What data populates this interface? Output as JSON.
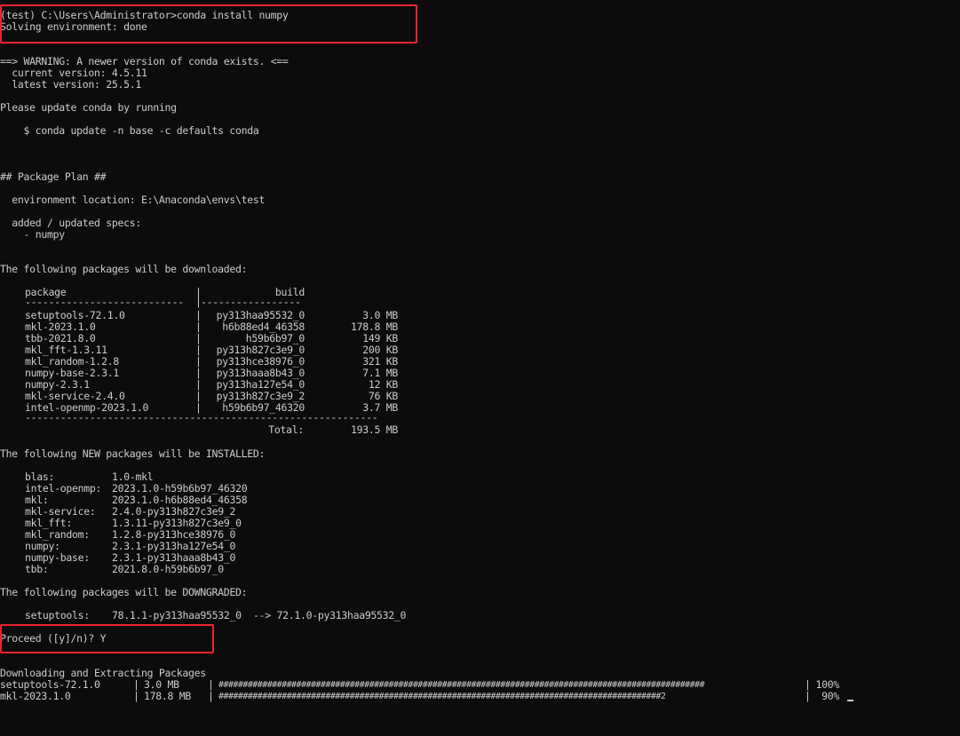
{
  "header": {
    "prompt": "(test) C:\\Users\\Administrator>conda install numpy",
    "solving": "Solving environment: done"
  },
  "warning": {
    "line1": "==> WARNING: A newer version of conda exists. <==",
    "current": "  current version: 4.5.11",
    "latest": "  latest version: 25.5.1",
    "update_msg": "Please update conda by running",
    "update_cmd": "    $ conda update -n base -c defaults conda"
  },
  "plan": {
    "title": "## Package Plan ##",
    "env_location": "  environment location: E:\\Anaconda\\envs\\test",
    "specs_label": "  added / updated specs:",
    "spec_item": "    - numpy"
  },
  "download": {
    "heading": "The following packages will be downloaded:",
    "col_package": "package",
    "col_build": "build",
    "dash_left": "---------------------------",
    "dash_right": "-----------------",
    "sep": "|",
    "rows": [
      {
        "package": "setuptools-72.1.0",
        "build": "py313haa95532_0",
        "size": "3.0 MB"
      },
      {
        "package": "mkl-2023.1.0",
        "build": "h6b88ed4_46358",
        "size": "178.8 MB"
      },
      {
        "package": "tbb-2021.8.0",
        "build": "h59b6b97_0",
        "size": "149 KB"
      },
      {
        "package": "mkl_fft-1.3.11",
        "build": "py313h827c3e9_0",
        "size": "200 KB"
      },
      {
        "package": "mkl_random-1.2.8",
        "build": "py313hce38976_0",
        "size": "321 KB"
      },
      {
        "package": "numpy-base-2.3.1",
        "build": "py313haaa8b43_0",
        "size": "7.1 MB"
      },
      {
        "package": "numpy-2.3.1",
        "build": "py313ha127e54_0",
        "size": "12 KB"
      },
      {
        "package": "mkl-service-2.4.0",
        "build": "py313h827c3e9_2",
        "size": "76 KB"
      },
      {
        "package": "intel-openmp-2023.1.0",
        "build": "h59b6b97_46320",
        "size": "3.7 MB"
      }
    ],
    "footer_dash": "------------------------------------------------------------",
    "total_label": "Total:",
    "total_value": "193.5 MB"
  },
  "new_pkgs": {
    "heading": "The following NEW packages will be INSTALLED:",
    "rows": [
      {
        "name": "blas:",
        "spec": "1.0-mkl"
      },
      {
        "name": "intel-openmp:",
        "spec": "2023.1.0-h59b6b97_46320"
      },
      {
        "name": "mkl:",
        "spec": "2023.1.0-h6b88ed4_46358"
      },
      {
        "name": "mkl-service:",
        "spec": "2.4.0-py313h827c3e9_2"
      },
      {
        "name": "mkl_fft:",
        "spec": "1.3.11-py313h827c3e9_0"
      },
      {
        "name": "mkl_random:",
        "spec": "1.2.8-py313hce38976_0"
      },
      {
        "name": "numpy:",
        "spec": "2.3.1-py313ha127e54_0"
      },
      {
        "name": "numpy-base:",
        "spec": "2.3.1-py313haaa8b43_0"
      },
      {
        "name": "tbb:",
        "spec": "2021.8.0-h59b6b97_0"
      }
    ]
  },
  "downgraded": {
    "heading": "The following packages will be DOWNGRADED:",
    "name": "setuptools:",
    "spec": "78.1.1-py313haa95532_0  --> 72.1.0-py313haa95532_0"
  },
  "proceed": "Proceed ([y]/n)? Y",
  "progress": {
    "heading": "Downloading and Extracting Packages",
    "rows": [
      {
        "name": "setuptools-72.1.0",
        "size": "3.0 MB",
        "bar": "####################################################################################################",
        "pct": "100%",
        "fraction": 1.0
      },
      {
        "name": "mkl-2023.1.0",
        "size": "178.8 MB",
        "bar": "###########################################################################################2",
        "pct": "90%",
        "fraction": 0.9
      }
    ]
  },
  "colors": {
    "background": "#0c0c0c",
    "text": "#cccccc",
    "highlight_box": "#e8262b"
  }
}
